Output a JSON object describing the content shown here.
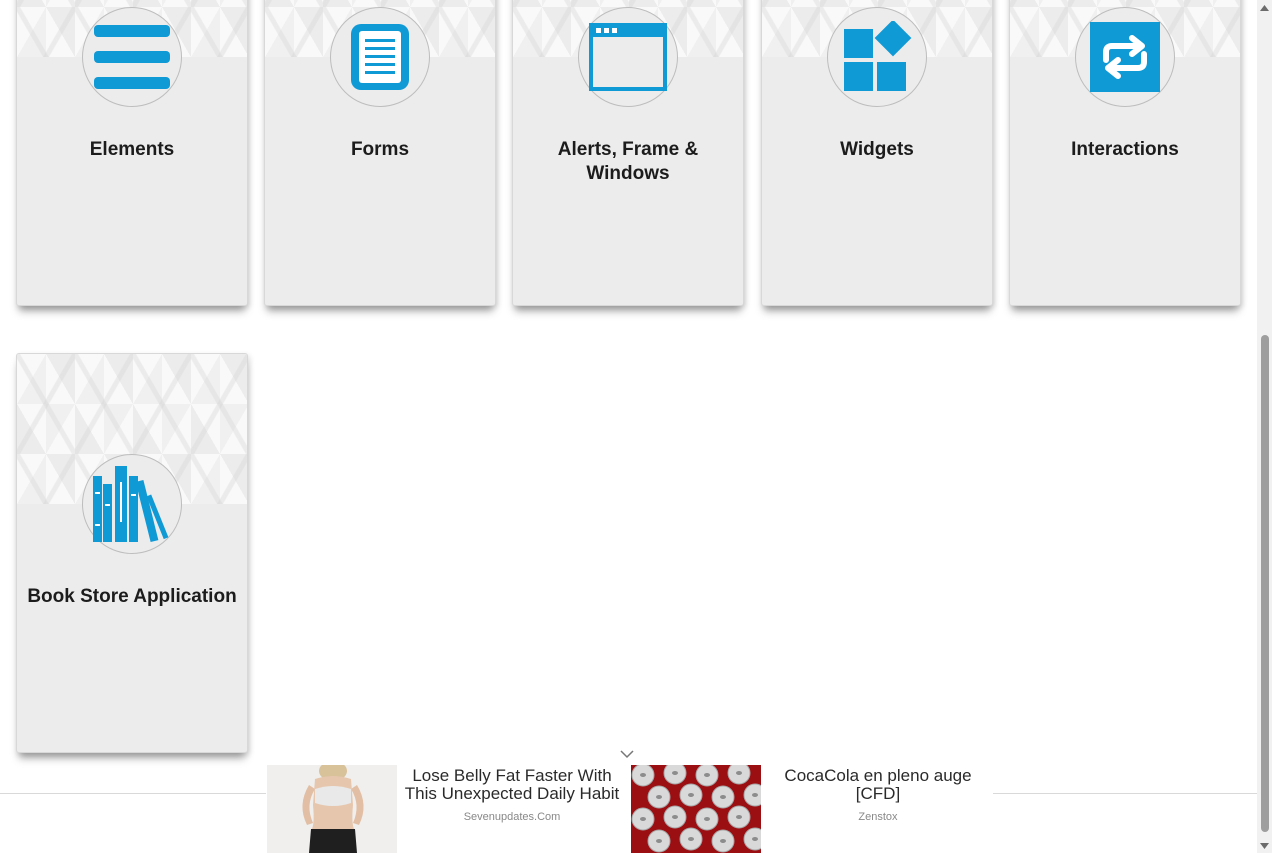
{
  "cards": [
    {
      "title": "Elements",
      "icon": "hamburger-list-icon"
    },
    {
      "title": "Forms",
      "icon": "document-form-icon"
    },
    {
      "title": "Alerts, Frame & Windows",
      "icon": "browser-window-icon"
    },
    {
      "title": "Widgets",
      "icon": "widgets-blocks-icon"
    },
    {
      "title": "Interactions",
      "icon": "repeat-arrows-icon"
    },
    {
      "title": "Book Store Application",
      "icon": "books-icon"
    }
  ],
  "ads": [
    {
      "headline": "Lose Belly Fat Faster With This Unexpected Daily Habit",
      "source": "Sevenupdates.Com",
      "image": "fitness-woman-photo"
    },
    {
      "headline": "CocaCola en pleno auge [CFD]",
      "source": "Zenstox",
      "image": "soda-cans-photo"
    }
  ],
  "colors": {
    "accent": "#0f9ad6",
    "card_bg": "#ececec",
    "title_text": "#1c1c1c"
  },
  "scrollbar": {
    "up_icon": "arrow-up-icon",
    "down_icon": "arrow-down-icon"
  }
}
